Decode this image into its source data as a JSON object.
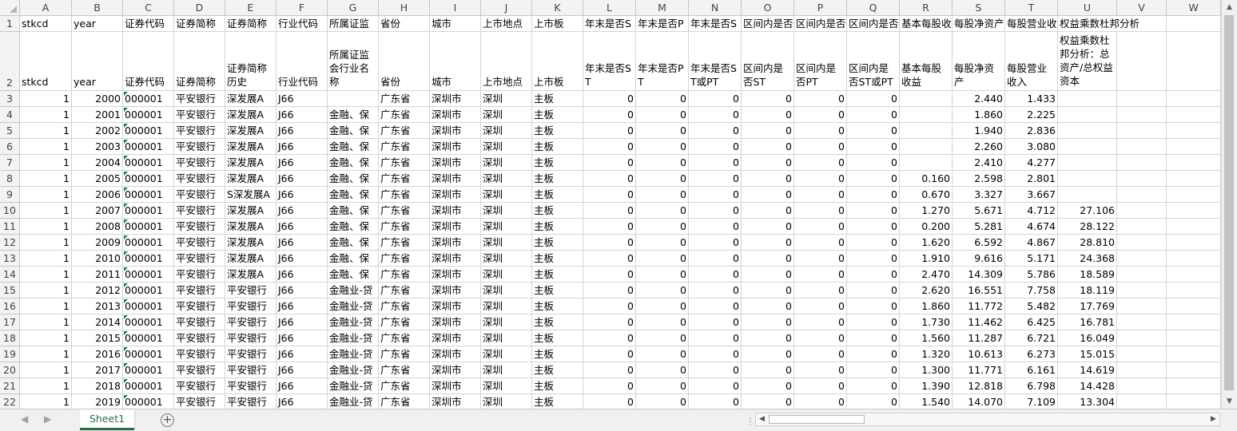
{
  "columns": [
    "A",
    "B",
    "C",
    "D",
    "E",
    "F",
    "G",
    "H",
    "I",
    "J",
    "K",
    "L",
    "M",
    "N",
    "O",
    "P",
    "Q",
    "R",
    "S",
    "T",
    "U",
    "V",
    "W"
  ],
  "header_row1": [
    "stkcd",
    "year",
    "证券代码",
    "证券简称",
    "证券简称",
    "行业代码",
    "所属证监",
    "省份",
    "城市",
    "上市地点",
    "上市板",
    "年末是否S",
    "年末是否P",
    "年末是否S",
    "区间内是否",
    "区间内是否",
    "区间内是否",
    "基本每股收",
    "每股净资产",
    "每股营业收",
    "权益乘数杜邦分析",
    "",
    ""
  ],
  "header_row2": [
    "stkcd",
    "year",
    "证券代码",
    "证券简称",
    "证券简称历史",
    "行业代码",
    "所属证监会行业名称",
    "省份",
    "城市",
    "上市地点",
    "上市板",
    "年末是否ST",
    "年末是否PT",
    "年末是否ST或PT",
    "区间内是否ST",
    "区间内是否PT",
    "区间内是否ST或PT",
    "基本每股收益",
    "每股净资产",
    "每股营业收入",
    "权益乘数杜邦分析：总资产/总权益资本",
    "",
    ""
  ],
  "rows": [
    [
      "1",
      "2000",
      "000001",
      "平安银行",
      "深发展A",
      "J66",
      "",
      "广东省",
      "深圳市",
      "深圳",
      "主板",
      "0",
      "0",
      "0",
      "0",
      "0",
      "0",
      "",
      "2.440",
      "1.433",
      ""
    ],
    [
      "1",
      "2001",
      "000001",
      "平安银行",
      "深发展A",
      "J66",
      "金融、保",
      "广东省",
      "深圳市",
      "深圳",
      "主板",
      "0",
      "0",
      "0",
      "0",
      "0",
      "0",
      "",
      "1.860",
      "2.225",
      ""
    ],
    [
      "1",
      "2002",
      "000001",
      "平安银行",
      "深发展A",
      "J66",
      "金融、保",
      "广东省",
      "深圳市",
      "深圳",
      "主板",
      "0",
      "0",
      "0",
      "0",
      "0",
      "0",
      "",
      "1.940",
      "2.836",
      ""
    ],
    [
      "1",
      "2003",
      "000001",
      "平安银行",
      "深发展A",
      "J66",
      "金融、保",
      "广东省",
      "深圳市",
      "深圳",
      "主板",
      "0",
      "0",
      "0",
      "0",
      "0",
      "0",
      "",
      "2.260",
      "3.080",
      ""
    ],
    [
      "1",
      "2004",
      "000001",
      "平安银行",
      "深发展A",
      "J66",
      "金融、保",
      "广东省",
      "深圳市",
      "深圳",
      "主板",
      "0",
      "0",
      "0",
      "0",
      "0",
      "0",
      "",
      "2.410",
      "4.277",
      ""
    ],
    [
      "1",
      "2005",
      "000001",
      "平安银行",
      "深发展A",
      "J66",
      "金融、保",
      "广东省",
      "深圳市",
      "深圳",
      "主板",
      "0",
      "0",
      "0",
      "0",
      "0",
      "0",
      "0.160",
      "2.598",
      "2.801",
      ""
    ],
    [
      "1",
      "2006",
      "000001",
      "平安银行",
      "S深发展A",
      "J66",
      "金融、保",
      "广东省",
      "深圳市",
      "深圳",
      "主板",
      "0",
      "0",
      "0",
      "0",
      "0",
      "0",
      "0.670",
      "3.327",
      "3.667",
      ""
    ],
    [
      "1",
      "2007",
      "000001",
      "平安银行",
      "深发展A",
      "J66",
      "金融、保",
      "广东省",
      "深圳市",
      "深圳",
      "主板",
      "0",
      "0",
      "0",
      "0",
      "0",
      "0",
      "1.270",
      "5.671",
      "4.712",
      "27.106"
    ],
    [
      "1",
      "2008",
      "000001",
      "平安银行",
      "深发展A",
      "J66",
      "金融、保",
      "广东省",
      "深圳市",
      "深圳",
      "主板",
      "0",
      "0",
      "0",
      "0",
      "0",
      "0",
      "0.200",
      "5.281",
      "4.674",
      "28.122"
    ],
    [
      "1",
      "2009",
      "000001",
      "平安银行",
      "深发展A",
      "J66",
      "金融、保",
      "广东省",
      "深圳市",
      "深圳",
      "主板",
      "0",
      "0",
      "0",
      "0",
      "0",
      "0",
      "1.620",
      "6.592",
      "4.867",
      "28.810"
    ],
    [
      "1",
      "2010",
      "000001",
      "平安银行",
      "深发展A",
      "J66",
      "金融、保",
      "广东省",
      "深圳市",
      "深圳",
      "主板",
      "0",
      "0",
      "0",
      "0",
      "0",
      "0",
      "1.910",
      "9.616",
      "5.171",
      "24.368"
    ],
    [
      "1",
      "2011",
      "000001",
      "平安银行",
      "深发展A",
      "J66",
      "金融、保",
      "广东省",
      "深圳市",
      "深圳",
      "主板",
      "0",
      "0",
      "0",
      "0",
      "0",
      "0",
      "2.470",
      "14.309",
      "5.786",
      "18.589"
    ],
    [
      "1",
      "2012",
      "000001",
      "平安银行",
      "平安银行",
      "J66",
      "金融业-贷",
      "广东省",
      "深圳市",
      "深圳",
      "主板",
      "0",
      "0",
      "0",
      "0",
      "0",
      "0",
      "2.620",
      "16.551",
      "7.758",
      "18.119"
    ],
    [
      "1",
      "2013",
      "000001",
      "平安银行",
      "平安银行",
      "J66",
      "金融业-贷",
      "广东省",
      "深圳市",
      "深圳",
      "主板",
      "0",
      "0",
      "0",
      "0",
      "0",
      "0",
      "1.860",
      "11.772",
      "5.482",
      "17.769"
    ],
    [
      "1",
      "2014",
      "000001",
      "平安银行",
      "平安银行",
      "J66",
      "金融业-贷",
      "广东省",
      "深圳市",
      "深圳",
      "主板",
      "0",
      "0",
      "0",
      "0",
      "0",
      "0",
      "1.730",
      "11.462",
      "6.425",
      "16.781"
    ],
    [
      "1",
      "2015",
      "000001",
      "平安银行",
      "平安银行",
      "J66",
      "金融业-贷",
      "广东省",
      "深圳市",
      "深圳",
      "主板",
      "0",
      "0",
      "0",
      "0",
      "0",
      "0",
      "1.560",
      "11.287",
      "6.721",
      "16.049"
    ],
    [
      "1",
      "2016",
      "000001",
      "平安银行",
      "平安银行",
      "J66",
      "金融业-贷",
      "广东省",
      "深圳市",
      "深圳",
      "主板",
      "0",
      "0",
      "0",
      "0",
      "0",
      "0",
      "1.320",
      "10.613",
      "6.273",
      "15.015"
    ],
    [
      "1",
      "2017",
      "000001",
      "平安银行",
      "平安银行",
      "J66",
      "金融业-贷",
      "广东省",
      "深圳市",
      "深圳",
      "主板",
      "0",
      "0",
      "0",
      "0",
      "0",
      "0",
      "1.300",
      "11.771",
      "6.161",
      "14.619"
    ],
    [
      "1",
      "2018",
      "000001",
      "平安银行",
      "平安银行",
      "J66",
      "金融业-贷",
      "广东省",
      "深圳市",
      "深圳",
      "主板",
      "0",
      "0",
      "0",
      "0",
      "0",
      "0",
      "1.390",
      "12.818",
      "6.798",
      "14.428"
    ],
    [
      "1",
      "2019",
      "000001",
      "平安银行",
      "平安银行",
      "J66",
      "金融业-贷",
      "广东省",
      "深圳市",
      "深圳",
      "主板",
      "0",
      "0",
      "0",
      "0",
      "0",
      "0",
      "1.540",
      "14.070",
      "7.109",
      "13.304"
    ]
  ],
  "sheet_tabs": [
    "Sheet1"
  ],
  "icons": {
    "add_sheet": "plus-circle-icon",
    "nav_prev": "triangle-left-icon",
    "nav_next": "triangle-right-icon"
  },
  "colors": {
    "accent": "#217346",
    "header_bg": "#f3f3f3",
    "grid": "#d4d4d4",
    "text_indicator": "#1e7b45"
  }
}
